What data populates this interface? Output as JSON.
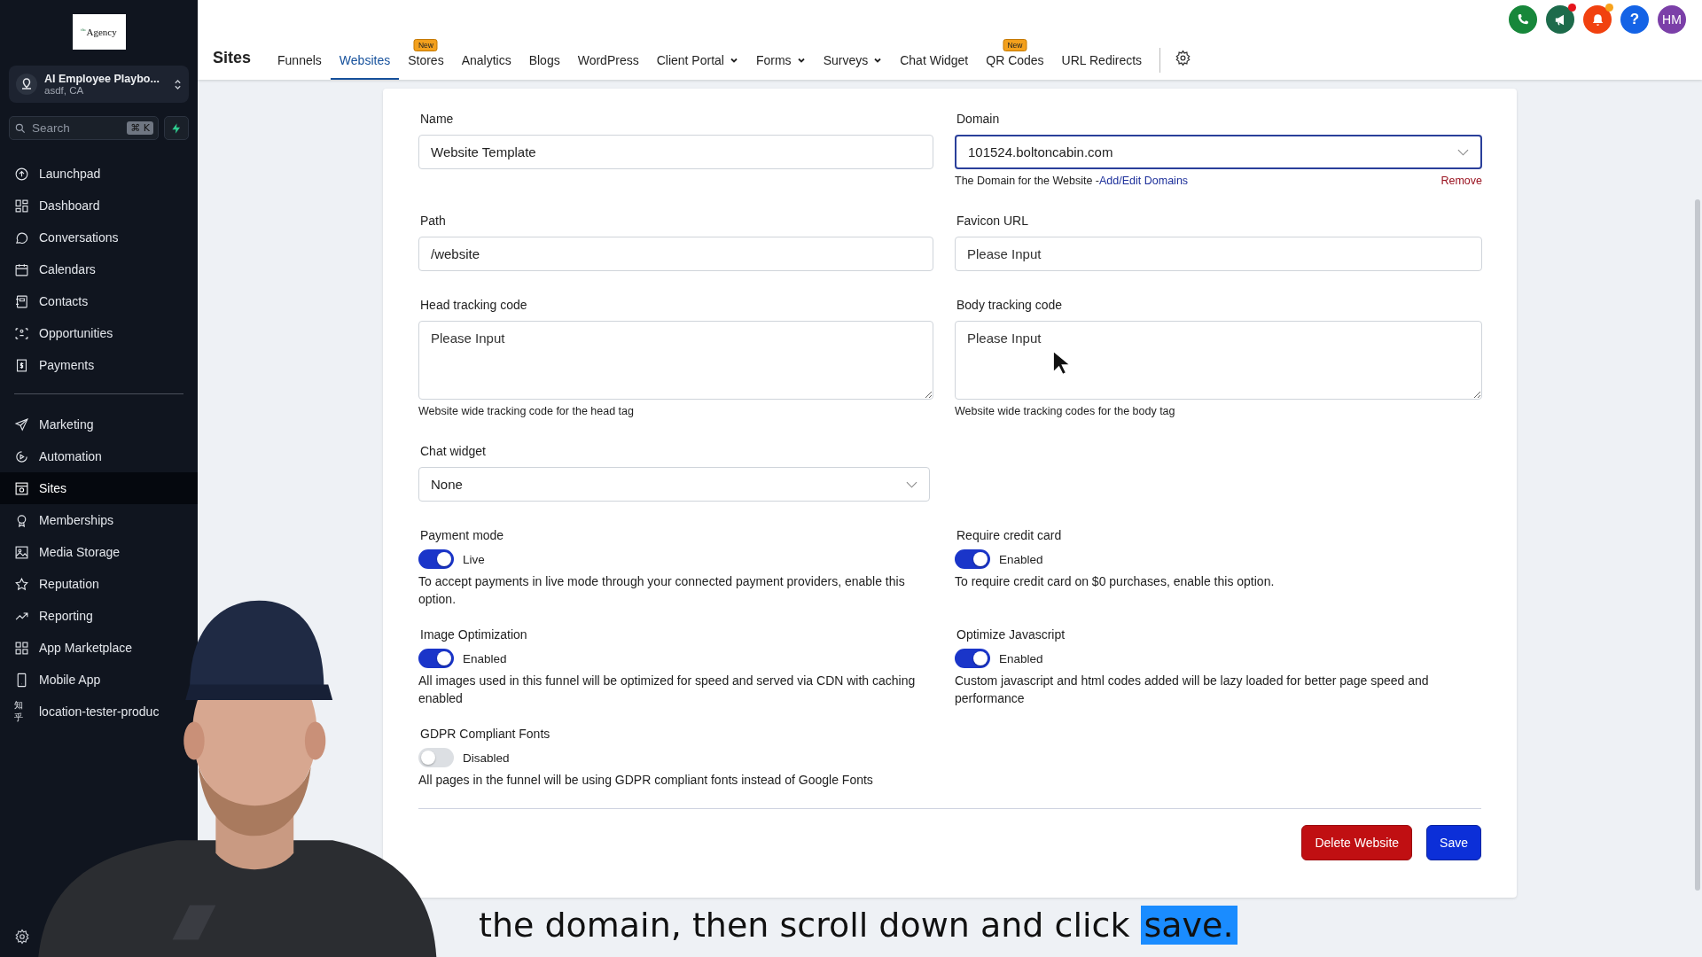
{
  "sidebar": {
    "logo": "$^{the}$Agency",
    "location": {
      "name": "AI Employee Playbo...",
      "address": "asdf, CA"
    },
    "search": {
      "placeholder": "Search",
      "shortcut": "⌘ K"
    },
    "sections": [
      {
        "items": [
          {
            "label": "Launchpad",
            "selected": false
          },
          {
            "label": "Dashboard",
            "selected": false
          },
          {
            "label": "Conversations",
            "selected": false
          },
          {
            "label": "Calendars",
            "selected": false
          },
          {
            "label": "Contacts",
            "selected": false
          },
          {
            "label": "Opportunities",
            "selected": false
          },
          {
            "label": "Payments",
            "selected": false
          }
        ]
      },
      {
        "items": [
          {
            "label": "Marketing",
            "selected": false
          },
          {
            "label": "Automation",
            "selected": false
          },
          {
            "label": "Sites",
            "selected": true
          },
          {
            "label": "Memberships",
            "selected": false
          },
          {
            "label": "Media Storage",
            "selected": false
          },
          {
            "label": "Reputation",
            "selected": false
          },
          {
            "label": "Reporting",
            "selected": false
          },
          {
            "label": "App Marketplace",
            "selected": false
          },
          {
            "label": "Mobile App",
            "selected": false
          },
          {
            "label": "location-tester-produc",
            "selected": false,
            "icon_text": "知乎"
          }
        ]
      }
    ]
  },
  "header": {
    "title": "Sites",
    "tabs": [
      {
        "label": "Funnels",
        "selected": false
      },
      {
        "label": "Websites",
        "selected": true
      },
      {
        "label": "Stores",
        "selected": false,
        "badge": "New"
      },
      {
        "label": "Analytics",
        "selected": false
      },
      {
        "label": "Blogs",
        "selected": false
      },
      {
        "label": "WordPress",
        "selected": false
      },
      {
        "label": "Client Portal",
        "selected": false,
        "dropdown": true
      },
      {
        "label": "Forms",
        "selected": false,
        "dropdown": true
      },
      {
        "label": "Surveys",
        "selected": false,
        "dropdown": true
      },
      {
        "label": "Chat Widget",
        "selected": false
      },
      {
        "label": "QR Codes",
        "selected": false,
        "badge": "New"
      },
      {
        "label": "URL Redirects",
        "selected": false
      }
    ],
    "help": "?",
    "avatar": "HM"
  },
  "form": {
    "rows": [
      [
        {
          "kind": "text",
          "label": "Name",
          "value": "Website Template",
          "focused": false
        },
        {
          "kind": "select",
          "label": "Domain",
          "value": "101524.boltoncabin.com",
          "focused": true,
          "helper": "The Domain for the Website -",
          "link": "Add/Edit Domains",
          "action": "Remove"
        }
      ],
      [
        {
          "kind": "text",
          "label": "Path",
          "value": "/website",
          "focused": false
        },
        {
          "kind": "text",
          "label": "Favicon URL",
          "placeholder": "Please Input",
          "focused": false
        }
      ],
      [
        {
          "kind": "textarea",
          "label": "Head tracking code",
          "placeholder": "Please Input",
          "focused": false,
          "helper": "Website wide tracking code for the head tag"
        },
        {
          "kind": "textarea",
          "label": "Body tracking code",
          "placeholder": "Please Input",
          "focused": false,
          "helper": "Website wide tracking codes for the body tag"
        }
      ],
      [
        {
          "kind": "select",
          "label": "Chat widget",
          "value": "None",
          "focused": false
        }
      ],
      [
        {
          "kind": "toggle",
          "label": "Payment mode",
          "on": true,
          "state_label": "Live",
          "description": "To accept payments in live mode through your connected payment providers, enable this option."
        },
        {
          "kind": "toggle",
          "label": "Require credit card",
          "on": true,
          "state_label": "Enabled",
          "description": "To require credit card on $0 purchases, enable this option."
        }
      ],
      [
        {
          "kind": "toggle",
          "label": "Image Optimization",
          "on": true,
          "state_label": "Enabled",
          "description": "All images used in this funnel will be optimized for speed and served via CDN with caching enabled"
        },
        {
          "kind": "toggle",
          "label": "Optimize Javascript",
          "on": true,
          "state_label": "Enabled",
          "description": "Custom javascript and html codes added will be lazy loaded for better page speed and performance"
        }
      ],
      [
        {
          "kind": "toggle",
          "label": "GDPR Compliant Fonts",
          "on": false,
          "state_label": "Disabled",
          "description": "All pages in the funnel will be using GDPR compliant fonts instead of Google Fonts"
        }
      ]
    ],
    "buttons": [
      {
        "label": "Delete Website",
        "kind": "danger"
      },
      {
        "label": "Save",
        "kind": "primary"
      }
    ]
  },
  "caption": {
    "text": "the domain, then scroll down and click",
    "highlight": "save."
  }
}
